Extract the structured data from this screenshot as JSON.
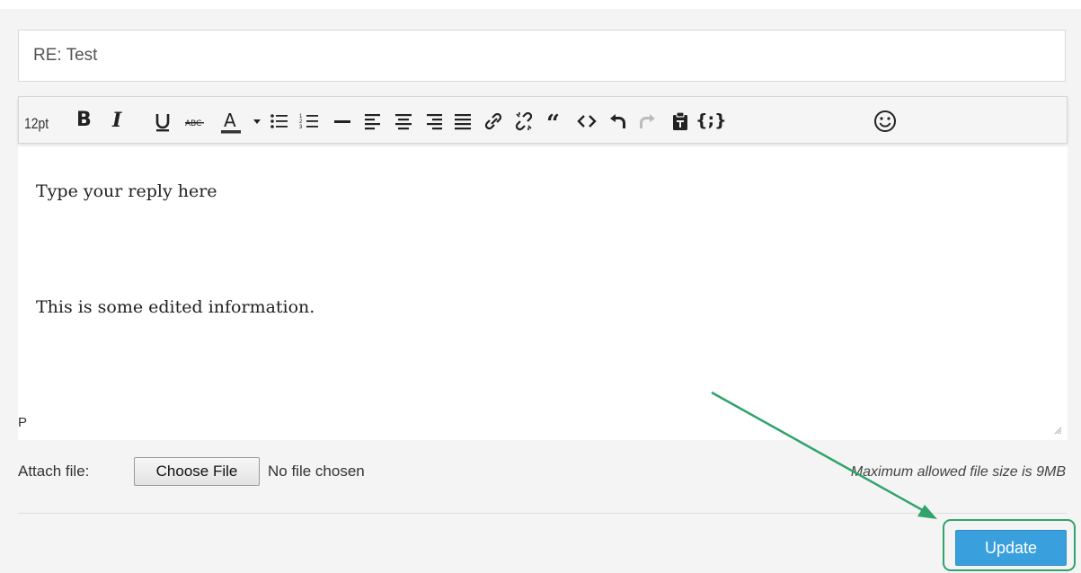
{
  "form": {
    "subject_value": "RE: Test"
  },
  "toolbar": {
    "font_size": "12pt",
    "buttons": [
      {
        "name": "bold-button",
        "icon": "bold-icon",
        "glyph": "B"
      },
      {
        "name": "italic-button",
        "icon": "italic-icon",
        "glyph": "I"
      },
      {
        "name": "underline-button",
        "icon": "underline-icon"
      },
      {
        "name": "strikethrough-button",
        "icon": "strikethrough-icon"
      },
      {
        "name": "text-color-button",
        "icon": "text-color-icon"
      },
      {
        "name": "text-color-dropdown",
        "icon": "caret-down-icon"
      },
      {
        "name": "bullet-list-button",
        "icon": "bullet-list-icon"
      },
      {
        "name": "numbered-list-button",
        "icon": "numbered-list-icon"
      },
      {
        "name": "horizontal-rule-button",
        "icon": "horizontal-rule-icon"
      },
      {
        "name": "align-left-button",
        "icon": "align-left-icon"
      },
      {
        "name": "align-center-button",
        "icon": "align-center-icon"
      },
      {
        "name": "align-right-button",
        "icon": "align-right-icon"
      },
      {
        "name": "align-justify-button",
        "icon": "align-justify-icon"
      },
      {
        "name": "link-button",
        "icon": "link-icon"
      },
      {
        "name": "unlink-button",
        "icon": "unlink-icon"
      },
      {
        "name": "blockquote-button",
        "icon": "quote-icon"
      },
      {
        "name": "source-code-button",
        "icon": "code-icon"
      },
      {
        "name": "undo-button",
        "icon": "undo-icon"
      },
      {
        "name": "redo-button",
        "icon": "redo-icon",
        "disabled": true
      },
      {
        "name": "paste-button",
        "icon": "clipboard-icon"
      },
      {
        "name": "code-sample-button",
        "icon": "code-braces-icon",
        "glyph": "{;}"
      },
      {
        "name": "emoticons-button",
        "icon": "smiley-icon"
      }
    ]
  },
  "editor": {
    "placeholder_line": "Type your reply here",
    "body_line": "This is some edited information.",
    "path_indicator": "P"
  },
  "attachment": {
    "label": "Attach file:",
    "button_label": "Choose File",
    "status": "No file chosen",
    "max_size_note": "Maximum allowed file size is 9MB"
  },
  "actions": {
    "update_label": "Update"
  },
  "colors": {
    "update_button": "#3aa0dd",
    "annotation_green": "#2fa36b",
    "page_background": "#f4f4f4"
  }
}
